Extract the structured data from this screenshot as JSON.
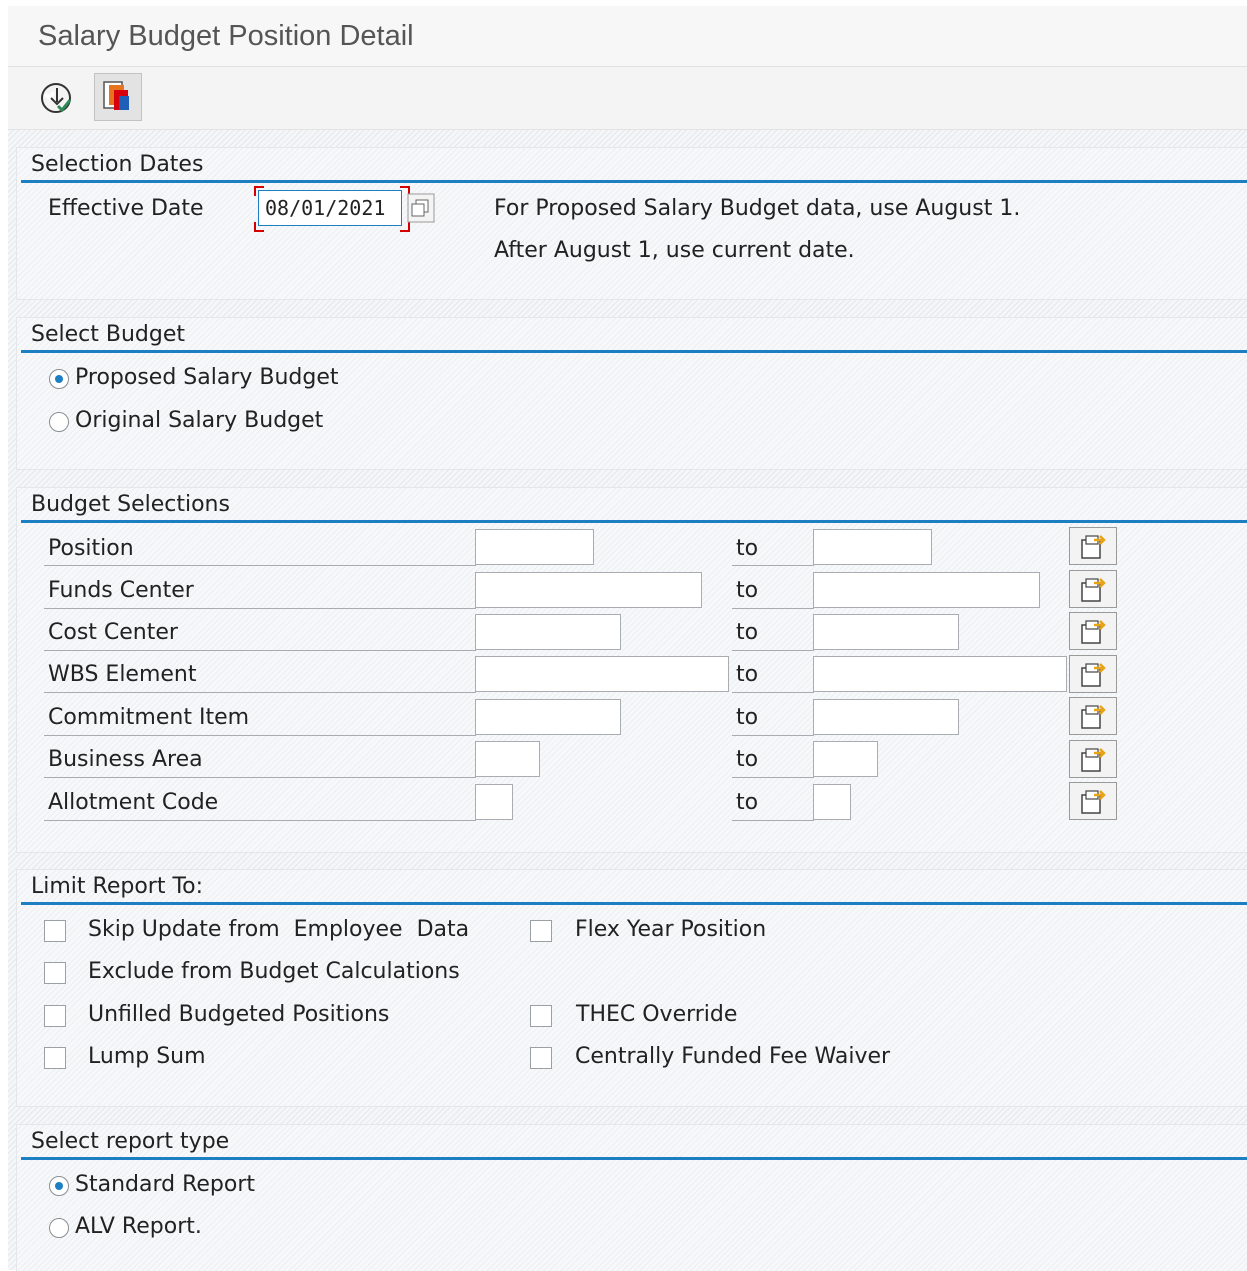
{
  "window": {
    "title": "Salary Budget Position Detail"
  },
  "toolbar": {
    "execute_icon": "execute-icon",
    "variant_icon": "get-variant-icon"
  },
  "selection_dates": {
    "title": "Selection Dates",
    "effective_date_label": "Effective Date",
    "effective_date_value": "08/01/2021",
    "note_line1": "For Proposed Salary Budget data, use August 1.",
    "note_line2": "After August 1, use current date."
  },
  "select_budget": {
    "title": "Select Budget",
    "options": [
      {
        "label": "Proposed Salary Budget",
        "selected": true
      },
      {
        "label": "Original Salary Budget",
        "selected": false
      }
    ]
  },
  "budget_selections": {
    "title": "Budget Selections",
    "to_label": "to",
    "rows": [
      {
        "label": "Position",
        "from": "",
        "to": ""
      },
      {
        "label": "Funds Center",
        "from": "",
        "to": ""
      },
      {
        "label": "Cost Center",
        "from": "",
        "to": ""
      },
      {
        "label": "WBS Element",
        "from": "",
        "to": ""
      },
      {
        "label": "Commitment Item",
        "from": "",
        "to": ""
      },
      {
        "label": "Business Area",
        "from": "",
        "to": ""
      },
      {
        "label": "Allotment Code",
        "from": "",
        "to": ""
      }
    ]
  },
  "limit_report": {
    "title": "Limit Report To:",
    "checkboxes": [
      {
        "label": "Skip Update from  Employee  Data",
        "checked": false
      },
      {
        "label": "Flex Year Position",
        "checked": false
      },
      {
        "label": "Exclude from Budget Calculations",
        "checked": false
      },
      {
        "label": "Unfilled Budgeted Positions",
        "checked": false
      },
      {
        "label": "THEC Override",
        "checked": false
      },
      {
        "label": "Lump Sum",
        "checked": false
      },
      {
        "label": "Centrally Funded Fee Waiver",
        "checked": false
      }
    ]
  },
  "report_type": {
    "title": "Select report type",
    "options": [
      {
        "label": "Standard Report",
        "selected": true
      },
      {
        "label": "ALV Report.",
        "selected": false
      }
    ]
  },
  "colors": {
    "accent": "#1c7fc2",
    "focus": "#d40000"
  }
}
